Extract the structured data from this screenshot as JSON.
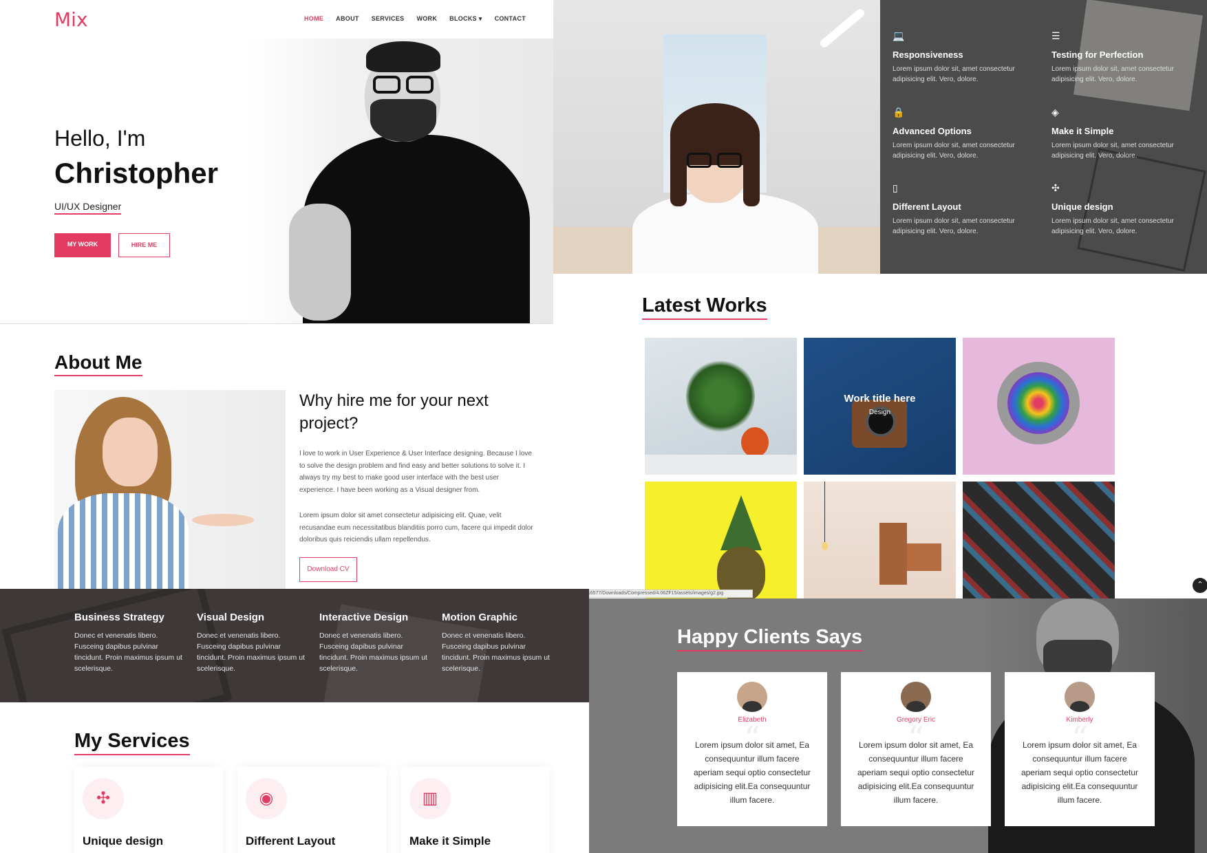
{
  "nav": {
    "logo": "Mix",
    "items": [
      "HOME",
      "ABOUT",
      "SERVICES",
      "WORK",
      "BLOCKS ▾",
      "CONTACT"
    ]
  },
  "hero": {
    "greeting": "Hello, I'm",
    "name": "Christopher",
    "role": "UI/UX Designer",
    "btn_work": "MY WORK",
    "btn_hire": "HIRE ME"
  },
  "features": {
    "items": [
      {
        "icon": "laptop-icon",
        "glyph": "💻",
        "title": "Responsiveness",
        "text": "Lorem ipsum dolor sit, amet consectetur adipisicing elit. Vero, dolore."
      },
      {
        "icon": "database-icon",
        "glyph": "☰",
        "title": "Testing for Perfection",
        "text": "Lorem ipsum dolor sit, amet consectetur adipisicing elit. Vero, dolore."
      },
      {
        "icon": "lock-icon",
        "glyph": "🔒",
        "title": "Advanced Options",
        "text": "Lorem ipsum dolor sit, amet consectetur adipisicing elit. Vero, dolore."
      },
      {
        "icon": "codepen-icon",
        "glyph": "◈",
        "title": "Make it Simple",
        "text": "Lorem ipsum dolor sit, amet consectetur adipisicing elit. Vero, dolore."
      },
      {
        "icon": "mobile-icon",
        "glyph": "▯",
        "title": "Different Layout",
        "text": "Lorem ipsum dolor sit, amet consectetur adipisicing elit. Vero, dolore."
      },
      {
        "icon": "pinwheel-icon",
        "glyph": "✣",
        "title": "Unique design",
        "text": "Lorem ipsum dolor sit, amet consectetur adipisicing elit. Vero, dolore."
      }
    ]
  },
  "about": {
    "title": "About Me",
    "heading": "Why hire me for your next project?",
    "para1": "I love to work in User Experience & User Interface designing. Because I love to solve the design problem and find easy and better solutions to solve it. I always try my best to make good user interface with the best user experience. I have been working as a Visual designer from.",
    "para2": "Lorem ipsum dolor sit amet consectetur adipisicing elit. Quae, velit recusandae eum necessitatibus blanditiis porro cum, facere qui impedit dolor doloribus quis reiciendis ullam repellendus.",
    "download": "Download CV"
  },
  "works": {
    "title": "Latest Works",
    "hover_title": "Work title here",
    "hover_sub": "Design",
    "status_url": "file:///C:/Users/16577/Downloads/Compressed/4.06ZF15/assets/images/g2.jpg",
    "back_to_top": "⌃"
  },
  "skills": [
    {
      "title": "Business Strategy",
      "text": "Donec et venenatis libero. Fusceing dapibus pulvinar tincidunt. Proin maximus ipsum ut scelerisque."
    },
    {
      "title": "Visual Design",
      "text": "Donec et venenatis libero. Fusceing dapibus pulvinar tincidunt. Proin maximus ipsum ut scelerisque."
    },
    {
      "title": "Interactive Design",
      "text": "Donec et venenatis libero. Fusceing dapibus pulvinar tincidunt. Proin maximus ipsum ut scelerisque."
    },
    {
      "title": "Motion Graphic",
      "text": "Donec et venenatis libero. Fusceing dapibus pulvinar tincidunt. Proin maximus ipsum ut scelerisque."
    }
  ],
  "services": {
    "title": "My Services",
    "items": [
      {
        "icon": "pinwheel-icon",
        "glyph": "✣",
        "label": "Unique design"
      },
      {
        "icon": "podcast-icon",
        "glyph": "◉",
        "label": "Different Layout"
      },
      {
        "icon": "bar-chart-icon",
        "glyph": "▥",
        "label": "Make it Simple"
      }
    ]
  },
  "clients": {
    "title": "Happy Clients Says",
    "quote_mark": "“",
    "items": [
      {
        "name": "Elizabeth",
        "text": "Lorem ipsum dolor sit amet, Ea consequuntur illum facere aperiam sequi optio consectetur adipisicing elit.Ea consequuntur illum facere."
      },
      {
        "name": "Gregory Eric",
        "text": "Lorem ipsum dolor sit amet, Ea consequuntur illum facere aperiam sequi optio consectetur adipisicing elit.Ea consequuntur illum facere."
      },
      {
        "name": "Kimberly",
        "text": "Lorem ipsum dolor sit amet, Ea consequuntur illum facere aperiam sequi optio consectetur adipisicing elit.Ea consequuntur illum facere."
      }
    ]
  },
  "colors": {
    "accent": "#e23c63",
    "dark": "#111111"
  }
}
